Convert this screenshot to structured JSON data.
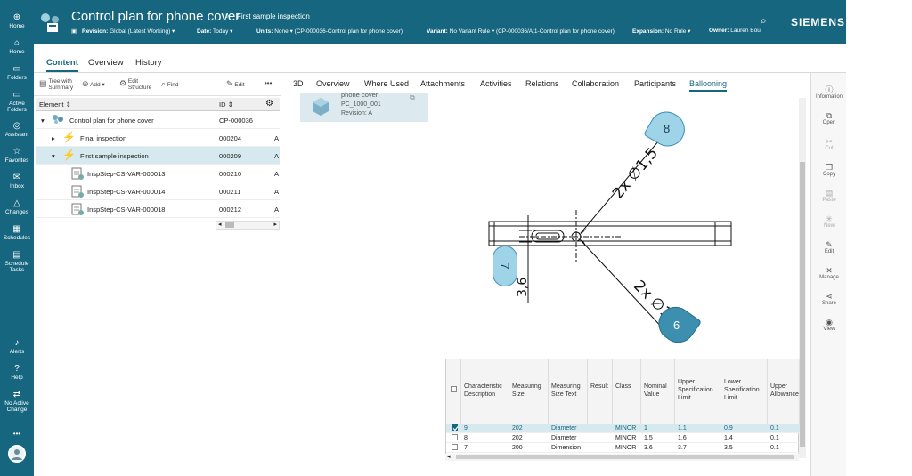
{
  "nav": {
    "items": [
      {
        "icon": "home-icon",
        "label": "Home"
      },
      {
        "icon": "home-icon",
        "label": "Home"
      },
      {
        "icon": "folder-icon",
        "label": "Folders"
      },
      {
        "icon": "folder-icon",
        "label": "Active Folders"
      },
      {
        "icon": "assistant-icon",
        "label": "Assistant"
      },
      {
        "icon": "star-icon",
        "label": "Favorites"
      },
      {
        "icon": "inbox-icon",
        "label": "Inbox"
      },
      {
        "icon": "changes-icon",
        "label": "Changes"
      },
      {
        "icon": "schedule-icon",
        "label": "Schedules"
      },
      {
        "icon": "tasks-icon",
        "label": "Schedule Tasks"
      }
    ],
    "bottom": [
      {
        "icon": "bell-icon",
        "label": "Alerts"
      },
      {
        "icon": "help-icon",
        "label": "Help"
      },
      {
        "icon": "change-icon",
        "label": "No Active Change"
      }
    ],
    "more": "•••"
  },
  "header": {
    "title": "Control plan for phone cover",
    "crumb_sep": ">",
    "crumb": "First sample inspection",
    "meta": {
      "revision_label": "Revision:",
      "revision": "Global (Latest Working)",
      "date_label": "Date:",
      "date": "Today",
      "units_label": "Units:",
      "units": "None",
      "cp": "(CP-000036-Control plan for phone cover)",
      "variant_label": "Variant:",
      "variant": "No Variant Rule",
      "variant_cp": "(CP-000036/A;1-Control plan for phone cover)",
      "expansion_label": "Expansion:",
      "expansion": "No Rule",
      "owner_label": "Owner:",
      "owner": "Lauren Bou"
    },
    "brand": "SIEMENS"
  },
  "tabs": {
    "content": "Content",
    "overview": "Overview",
    "history": "History"
  },
  "toolbar": {
    "tree": "Tree with Summary",
    "add": "Add",
    "edit_structure": "Edit Structure",
    "find": "Find",
    "edit": "Edit",
    "more": "•••"
  },
  "grid": {
    "col_element": "Element",
    "col_id": "ID",
    "rows": [
      {
        "name": "Control plan for phone cover",
        "id": "CP-000036",
        "extra": ""
      },
      {
        "name": "Final inspection",
        "id": "000204",
        "extra": "A"
      },
      {
        "name": "First sample inspection",
        "id": "000209",
        "extra": "A"
      },
      {
        "name": "InspStep-CS-VAR-000013",
        "id": "000210",
        "extra": "A"
      },
      {
        "name": "InspStep-CS-VAR-000014",
        "id": "000211",
        "extra": "A"
      },
      {
        "name": "InspStep-CS-VAR-000018",
        "id": "000212",
        "extra": "A"
      }
    ]
  },
  "tabs2": [
    "3D",
    "Overview",
    "Where Used",
    "Attachments",
    "Activities",
    "Relations",
    "Collaboration",
    "Participants",
    "Ballooning"
  ],
  "objcard": {
    "name": "phone cover",
    "id": "PC_1000_001",
    "revision": "Revision:  A"
  },
  "drawing": {
    "dim1": "2x ∅1,5",
    "dim2": "2x ∅1",
    "dim3": "3,6",
    "balloon8": "8",
    "balloon7": "7",
    "balloon9": "9"
  },
  "table": {
    "headers": [
      "Characteristic Description",
      "Measuring Size",
      "Measuring Size Text",
      "Result",
      "Class",
      "Nominal Value",
      "Upper Specification Limit",
      "Lower Specification Limit",
      "Upper Allowance"
    ],
    "rows": [
      {
        "checked": true,
        "desc": "9",
        "size": "202",
        "text": "Diameter",
        "result": "",
        "cls": "MINOR",
        "nom": "1",
        "usl": "1.1",
        "lsl": "0.9",
        "ua": "0.1"
      },
      {
        "checked": false,
        "desc": "8",
        "size": "202",
        "text": "Diameter",
        "result": "",
        "cls": "MINOR",
        "nom": "1.5",
        "usl": "1.6",
        "lsl": "1.4",
        "ua": "0.1"
      },
      {
        "checked": false,
        "desc": "7",
        "size": "200",
        "text": "Dimension",
        "result": "",
        "cls": "MINOR",
        "nom": "3.6",
        "usl": "3.7",
        "lsl": "3.5",
        "ua": "0.1"
      }
    ]
  },
  "rpanel": [
    {
      "icon": "info-icon",
      "label": "Information",
      "dim": false
    },
    {
      "icon": "open-icon",
      "label": "Open",
      "dim": false
    },
    {
      "icon": "cut-icon",
      "label": "Cut",
      "dim": true
    },
    {
      "icon": "copy-icon",
      "label": "Copy",
      "dim": false
    },
    {
      "icon": "paste-icon",
      "label": "Paste",
      "dim": true
    },
    {
      "icon": "new-icon",
      "label": "New",
      "dim": true
    },
    {
      "icon": "edit-icon",
      "label": "Edit",
      "dim": false
    },
    {
      "icon": "manage-icon",
      "label": "Manage",
      "dim": false
    },
    {
      "icon": "share-icon",
      "label": "Share",
      "dim": false
    },
    {
      "icon": "view-icon",
      "label": "View",
      "dim": false
    }
  ]
}
